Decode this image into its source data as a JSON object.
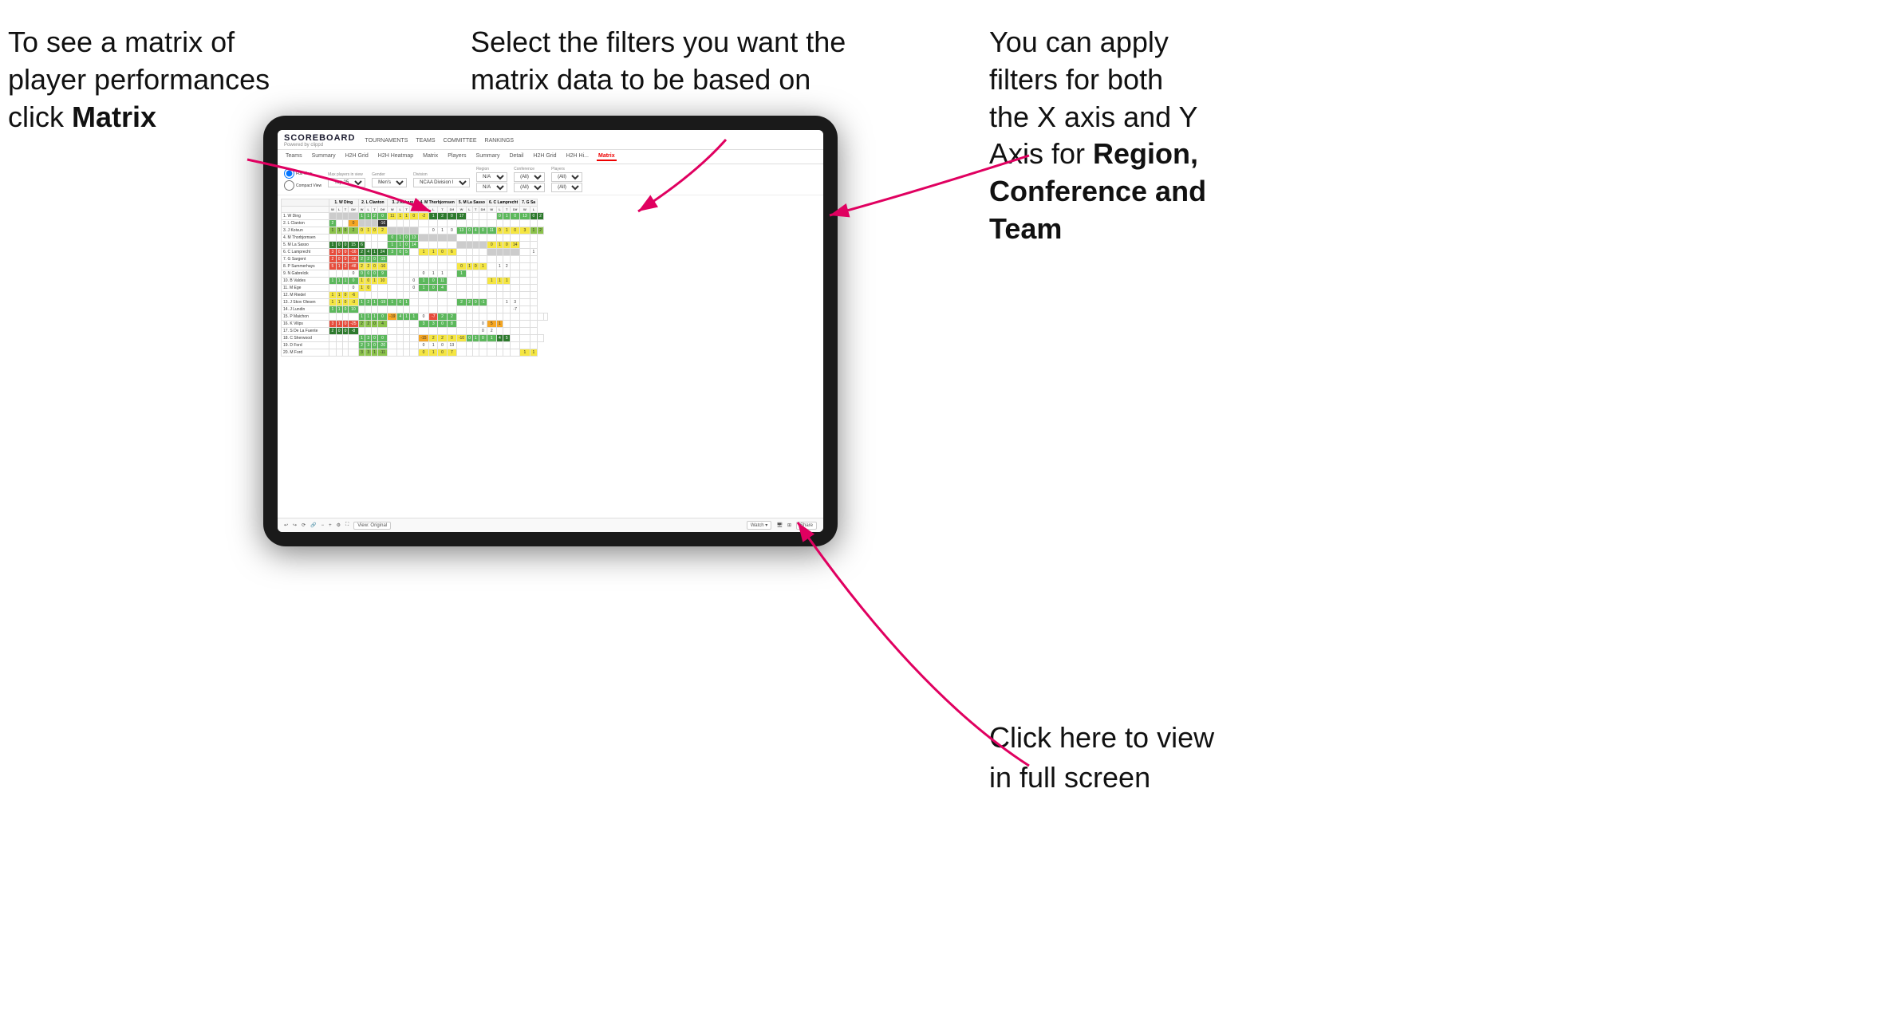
{
  "annotations": {
    "top_left": {
      "line1": "To see a matrix of",
      "line2": "player performances",
      "line3_prefix": "click ",
      "line3_bold": "Matrix"
    },
    "top_center": {
      "line1": "Select the filters you want the",
      "line2": "matrix data to be based on"
    },
    "top_right": {
      "line1": "You  can apply",
      "line2": "filters for both",
      "line3": "the X axis and Y",
      "line4_prefix": "Axis for ",
      "line4_bold": "Region,",
      "line5_bold": "Conference and",
      "line6_bold": "Team"
    },
    "bottom_right": {
      "line1": "Click here to view",
      "line2": "in full screen"
    }
  },
  "app": {
    "logo": "SCOREBOARD",
    "logo_sub": "Powered by clippd",
    "nav": [
      "TOURNAMENTS",
      "TEAMS",
      "COMMITTEE",
      "RANKINGS"
    ],
    "tabs_players": [
      "Teams",
      "Summary",
      "H2H Grid",
      "H2H Heatmap",
      "Matrix",
      "Players",
      "Summary",
      "Detail",
      "H2H Grid",
      "H2H Hi...",
      "Matrix"
    ],
    "active_tab": "Matrix",
    "filters": {
      "view_options": [
        "Full View",
        "Compact View"
      ],
      "max_players_label": "Max players in view",
      "max_players_value": "Top 25",
      "gender_label": "Gender",
      "gender_value": "Men's",
      "division_label": "Division",
      "division_value": "NCAA Division I",
      "region_label": "Region",
      "region_value": "N/A",
      "conference_label": "Conference",
      "conference_value": "(All)",
      "conference_value2": "(All)",
      "players_label": "Players",
      "players_value": "(All)",
      "players_value2": "(All)"
    },
    "matrix": {
      "col_headers": [
        "1. W Ding",
        "2. L Clanton",
        "3. J Koivun",
        "4. M Thorbjornsen",
        "5. M La Sasso",
        "6. C Lamprecht",
        "7. G Sa"
      ],
      "sub_headers": [
        "W",
        "L",
        "T",
        "Dif"
      ],
      "rows": [
        {
          "name": "1. W Ding",
          "cells": [
            "",
            "",
            "",
            "11",
            "2",
            "0",
            "11",
            "1",
            "1",
            "0",
            "-2",
            "1",
            "2",
            "0",
            "17",
            "",
            "",
            "",
            "0",
            "1",
            "0",
            "13",
            "0",
            "2"
          ]
        },
        {
          "name": "2. L Clanton",
          "cells": [
            "2",
            "",
            "",
            "0",
            "-16",
            "",
            "",
            "",
            "",
            "",
            "",
            "",
            "",
            "",
            "",
            "",
            "",
            "",
            "",
            "",
            "",
            "",
            "",
            ""
          ]
        },
        {
          "name": "3. J Koivun",
          "cells": [
            "1",
            "1",
            "0",
            "2",
            "0",
            "1",
            "0",
            "2",
            "",
            "",
            "",
            "",
            "0",
            "1",
            "0",
            "13",
            "0",
            "4",
            "0",
            "11",
            "0",
            "1",
            "0",
            "3"
          ]
        },
        {
          "name": "4. M Thorbjornsen",
          "cells": [
            "",
            "",
            "",
            "",
            "",
            "",
            "",
            "",
            "0",
            "1",
            "0",
            "13",
            "",
            "",
            "",
            "",
            "",
            "",
            "",
            "",
            "",
            "",
            "",
            ""
          ]
        },
        {
          "name": "5. M La Sasso",
          "cells": [
            "1",
            "0",
            "0",
            "15",
            "6",
            "",
            "",
            "",
            "1",
            "1",
            "0",
            "14",
            "",
            "",
            "",
            "",
            "0",
            "1",
            "0",
            "14",
            "",
            "",
            "",
            ""
          ]
        },
        {
          "name": "6. C Lamprecht",
          "cells": [
            "3",
            "0",
            "0",
            "-16",
            "2",
            "4",
            "1",
            "24",
            "3",
            "0",
            "5",
            "",
            "1",
            "1",
            "0",
            "6",
            "",
            "",
            "",
            "",
            "",
            "",
            "",
            ""
          ]
        },
        {
          "name": "7. G Sargent",
          "cells": [
            "2",
            "0",
            "0",
            "-16",
            "2",
            "2",
            "0",
            "-15",
            "",
            "",
            "",
            "",
            "",
            "",
            "",
            "",
            "",
            "",
            "",
            "",
            "",
            "",
            "",
            ""
          ]
        },
        {
          "name": "8. P Summerhays",
          "cells": [
            "5",
            "1",
            "2",
            "-48",
            "2",
            "2",
            "0",
            "-16",
            "",
            "",
            "",
            "",
            "",
            "",
            "",
            "",
            "0",
            "1",
            "0",
            "1",
            "",
            "1",
            "2",
            ""
          ]
        },
        {
          "name": "9. N Gabrelcik",
          "cells": [
            "",
            "",
            "",
            "0",
            "0",
            "0",
            "9",
            "",
            "",
            "",
            "",
            "0",
            "1",
            "1",
            "",
            "1",
            "",
            "",
            "",
            "",
            "",
            "",
            ""
          ]
        },
        {
          "name": "10. B Valdes",
          "cells": [
            "1",
            "1",
            "1",
            "0",
            "1",
            "0",
            "1",
            "10",
            "",
            "",
            "",
            "0",
            "1",
            "0",
            "11",
            "",
            "",
            "",
            "",
            "",
            "1",
            "1",
            "1",
            ""
          ]
        },
        {
          "name": "11. M Ege",
          "cells": [
            "",
            "",
            "",
            "0",
            "1",
            "0",
            "",
            "",
            "",
            "",
            "",
            "0",
            "1",
            "0",
            "4",
            "",
            "",
            "",
            "",
            ""
          ]
        },
        {
          "name": "12. M Riedel",
          "cells": [
            "1",
            "1",
            "0",
            "-6",
            "",
            "",
            "",
            "",
            "",
            "",
            "",
            "",
            "",
            "",
            "",
            "",
            "",
            "",
            "",
            "",
            "",
            "",
            "",
            ""
          ]
        },
        {
          "name": "13. J Skov Olesen",
          "cells": [
            "1",
            "1",
            "0",
            "-3",
            "1",
            "2",
            "1",
            "-19",
            "1",
            "0",
            "1",
            "",
            "",
            "",
            "",
            "",
            "2",
            "2",
            "0",
            "-1",
            "",
            "",
            "1",
            "3",
            ""
          ]
        },
        {
          "name": "14. J Lundin",
          "cells": [
            "1",
            "1",
            "0",
            "10",
            "",
            "",
            "",
            "",
            "",
            "",
            "",
            "",
            "",
            "",
            "",
            "",
            "",
            "",
            "",
            "",
            "",
            "",
            "-7",
            ""
          ]
        },
        {
          "name": "15. P Maichon",
          "cells": [
            "",
            "",
            "",
            "1",
            "1",
            "1",
            "0",
            "-19",
            "4",
            "1",
            "1",
            "0",
            "-7",
            "2",
            "2",
            ""
          ]
        },
        {
          "name": "16. K Vilips",
          "cells": [
            "3",
            "1",
            "0",
            "-25",
            "2",
            "2",
            "0",
            "4",
            "",
            "",
            "",
            "",
            "3",
            "3",
            "0",
            "8",
            "",
            "",
            "",
            "0",
            "5",
            "1",
            ""
          ]
        },
        {
          "name": "17. S De La Fuente",
          "cells": [
            "2",
            "0",
            "0",
            "-8",
            "",
            "",
            "",
            "",
            "",
            "",
            "",
            "",
            "",
            "",
            "",
            "",
            "",
            "",
            "",
            "0",
            "2",
            ""
          ]
        },
        {
          "name": "18. C Sherwood",
          "cells": [
            "",
            "",
            "",
            "1",
            "3",
            "0",
            "0",
            "",
            "",
            "",
            "",
            "2",
            "2",
            "0",
            "-10",
            "0",
            "1",
            "0",
            "1",
            "4",
            "5",
            ""
          ]
        },
        {
          "name": "19. D Ford",
          "cells": [
            "",
            "",
            "",
            "2",
            "3",
            "0",
            "-20",
            "",
            "",
            "",
            "",
            "0",
            "1",
            "0",
            "13",
            "",
            "",
            "",
            "",
            "",
            "",
            ""
          ]
        },
        {
          "name": "20. M Ford",
          "cells": [
            "",
            "",
            "",
            "3",
            "3",
            "1",
            "-11",
            "",
            "",
            "",
            "",
            "0",
            "1",
            "0",
            "7",
            "",
            "",
            "",
            "",
            "",
            "1",
            "1",
            "1",
            ""
          ]
        }
      ]
    },
    "toolbar": {
      "view_original": "View: Original",
      "watch": "Watch ▾",
      "share": "Share"
    }
  }
}
